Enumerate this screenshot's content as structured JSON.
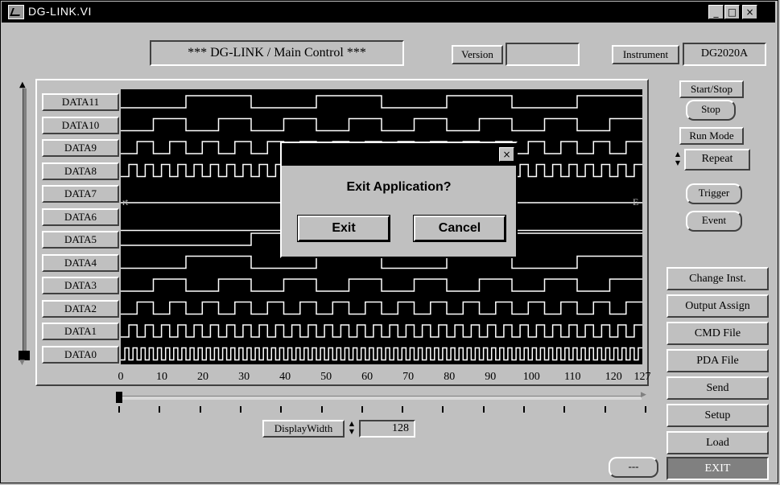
{
  "window": {
    "title": "DG-LINK.VI",
    "minimize_glyph": "_",
    "maximize_glyph": "□",
    "close_glyph": "×"
  },
  "header": {
    "title": "*** DG-LINK / Main Control ***",
    "version_label": "Version",
    "version_value": "",
    "instrument_label": "Instrument",
    "instrument_value": "DG2020A"
  },
  "graph": {
    "channels": [
      "DATA11",
      "DATA10",
      "DATA9",
      "DATA8",
      "DATA7",
      "DATA6",
      "DATA5",
      "DATA4",
      "DATA3",
      "DATA2",
      "DATA1",
      "DATA0"
    ],
    "x_ticks": [
      "0",
      "10",
      "20",
      "30",
      "40",
      "50",
      "60",
      "70",
      "80",
      "90",
      "100",
      "110",
      "120",
      "127"
    ],
    "start_marker": "rt",
    "end_marker": "E",
    "periods": [
      32,
      16,
      8,
      4,
      0,
      0,
      64,
      32,
      16,
      8,
      4,
      2
    ],
    "x_range": [
      0,
      127
    ]
  },
  "controls": {
    "display_width_label": "DisplayWidth",
    "display_width_value": "128",
    "start_stop_label": "Start/Stop",
    "stop_button": "Stop",
    "run_mode_label": "Run Mode",
    "run_mode_value": "Repeat",
    "trigger_button": "Trigger",
    "event_button": "Event",
    "status_button": "---"
  },
  "sidebar": {
    "buttons": [
      "Change Inst.",
      "Output Assign",
      "CMD File",
      "PDA File",
      "Send",
      "Setup",
      "Load"
    ],
    "exit_label": "EXIT"
  },
  "dialog": {
    "message": "Exit Application?",
    "exit_label": "Exit",
    "cancel_label": "Cancel",
    "close_glyph": "×"
  }
}
